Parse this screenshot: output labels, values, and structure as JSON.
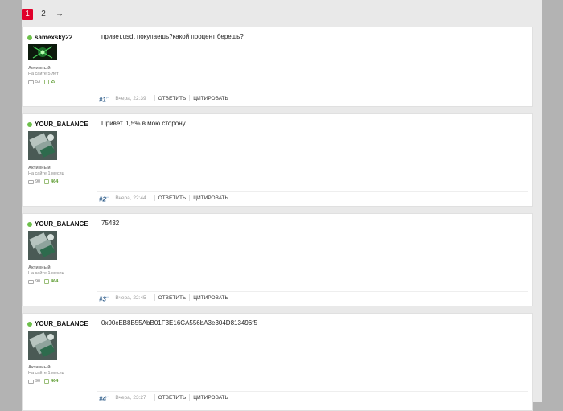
{
  "pagination": {
    "pages": [
      "1",
      "2"
    ],
    "active": "1",
    "next": "→"
  },
  "posts": [
    {
      "author": "samexsky22",
      "status": "Активный",
      "since": "На сайте 5 лет",
      "messages": "53",
      "likes": "29",
      "text": "привет,usdt покупаешь?какой процент берешь?",
      "number": "#1",
      "time": "Вчера, 22:39",
      "reply": "ОТВЕТИТЬ",
      "quote": "ЦИТИРОВАТЬ"
    },
    {
      "author": "YOUR_BALANCE",
      "status": "Активный",
      "since": "На сайте 1 месяц",
      "messages": "90",
      "likes": "464",
      "text": "Привет. 1,5% в мою сторону",
      "number": "#2",
      "time": "Вчера, 22:44",
      "reply": "ОТВЕТИТЬ",
      "quote": "ЦИТИРОВАТЬ"
    },
    {
      "author": "YOUR_BALANCE",
      "status": "Активный",
      "since": "На сайте 1 месяц",
      "messages": "90",
      "likes": "464",
      "text": "75432",
      "number": "#3",
      "time": "Вчера, 22:45",
      "reply": "ОТВЕТИТЬ",
      "quote": "ЦИТИРОВАТЬ"
    },
    {
      "author": "YOUR_BALANCE",
      "status": "Активный",
      "since": "На сайте 1 месяц",
      "messages": "90",
      "likes": "464",
      "text": "0x90cEB8B55AbB01F3E16CA556bA3e304D813496f5",
      "number": "#4",
      "time": "Вчера, 23:27",
      "reply": "ОТВЕТИТЬ",
      "quote": "ЦИТИРОВАТЬ"
    }
  ],
  "colors": {
    "accent": "#e0002a",
    "online": "#6cc04a",
    "post_number": "#2f5d8a"
  }
}
